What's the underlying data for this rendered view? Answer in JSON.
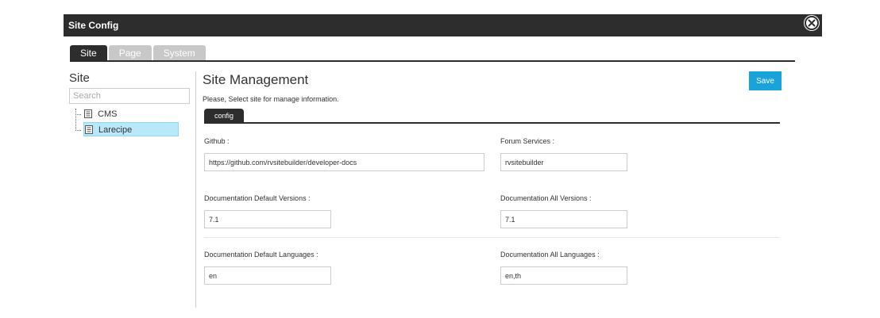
{
  "window": {
    "title": "Site Config"
  },
  "main_tabs": [
    {
      "label": "Site",
      "active": true
    },
    {
      "label": "Page",
      "active": false
    },
    {
      "label": "System",
      "active": false
    }
  ],
  "sidebar": {
    "title": "Site",
    "search_placeholder": "Search",
    "tree": [
      {
        "label": "CMS",
        "icon": "document-icon",
        "selected": false
      },
      {
        "label": "Larecipe",
        "icon": "document-icon",
        "selected": true
      }
    ]
  },
  "content": {
    "title": "Site Management",
    "instruction": "Please, Select site for manage information.",
    "save_label": "Save",
    "tab_label": "config",
    "fields": {
      "github": {
        "label": "Github :",
        "value": "https://github.com/rvsitebuilder/developer-docs"
      },
      "forum_services": {
        "label": "Forum Services :",
        "value": "rvsitebuilder"
      },
      "doc_default_versions": {
        "label": "Documentation Default Versions :",
        "value": "7.1"
      },
      "doc_all_versions": {
        "label": "Documentation All Versions :",
        "value": "7.1"
      },
      "doc_default_languages": {
        "label": "Documentation Default Languages :",
        "value": "en"
      },
      "doc_all_languages": {
        "label": "Documentation All Languages :",
        "value": "en,th"
      }
    }
  },
  "colors": {
    "titlebar": "#2d2d2d",
    "accent": "#1aa3d9",
    "selected_row": "#b8e8f9",
    "inactive_tab": "#c8c8c8"
  }
}
